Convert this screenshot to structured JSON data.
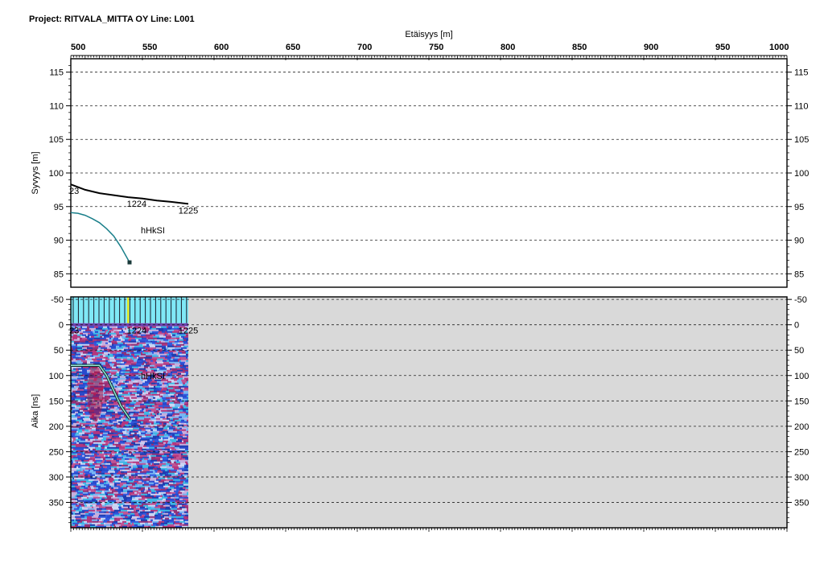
{
  "header": {
    "title": "Project: RITVALA_MITTA OY  Line: L001"
  },
  "chart_data": [
    {
      "type": "line",
      "title": "",
      "xlabel": "Etäisyys [m]",
      "ylabel": "Syvyys [m]",
      "xlim": [
        500,
        1000
      ],
      "ylim": [
        83,
        117
      ],
      "x_ticks": [
        "500",
        "550",
        "600",
        "650",
        "700",
        "750",
        "800",
        "850",
        "900",
        "950",
        "1000"
      ],
      "y_ticks": [
        "85",
        "90",
        "95",
        "100",
        "105",
        "110",
        "115"
      ],
      "grid": true,
      "series": [
        {
          "name": "",
          "color": "#000000",
          "x": [
            500,
            510,
            520,
            530,
            540,
            550,
            560,
            570,
            582
          ],
          "y": [
            98.3,
            97.5,
            97.0,
            96.7,
            96.4,
            96.2,
            95.9,
            95.7,
            95.4
          ]
        },
        {
          "name": "",
          "color": "#1a7f8a",
          "x": [
            500,
            505,
            510,
            515,
            520,
            525,
            530,
            535,
            541
          ],
          "y": [
            94.1,
            94.0,
            93.7,
            93.2,
            92.6,
            91.7,
            90.6,
            89.0,
            86.7
          ]
        }
      ],
      "point_labels": [
        {
          "text": "23",
          "x": 500,
          "y": 98.3
        },
        {
          "text": "1224",
          "x": 538,
          "y": 96.4
        },
        {
          "text": "1225",
          "x": 574,
          "y": 95.4
        }
      ],
      "annotations": [
        {
          "text": "hHkSI",
          "x": 550,
          "y": 91.5
        }
      ]
    },
    {
      "type": "heatmap",
      "title": "",
      "xlabel": "",
      "ylabel": "Aika [ns]",
      "xlim": [
        500,
        1000
      ],
      "ylim": [
        -55,
        400
      ],
      "data_x_range": [
        500,
        582
      ],
      "y_ticks": [
        "-50",
        "0",
        "50",
        "100",
        "150",
        "200",
        "250",
        "300",
        "350"
      ],
      "grid": true,
      "surface_marker_x": 540,
      "colors": {
        "background": "#d9d9d9",
        "header": "#7fe8f6",
        "signal_low": "#1e3cc8",
        "signal_high": "#e0205a",
        "interface": "#8fe0d0"
      },
      "interface_line": {
        "x": [
          500,
          520,
          525,
          530,
          535,
          541
        ],
        "y": [
          80,
          80,
          100,
          130,
          160,
          185
        ]
      },
      "point_labels": [
        {
          "text": "23",
          "x": 500,
          "y": 12
        },
        {
          "text": "1224",
          "x": 538,
          "y": 12
        },
        {
          "text": "1225",
          "x": 574,
          "y": 12
        }
      ],
      "annotations": [
        {
          "text": "hHkSI",
          "x": 550,
          "y": 100
        }
      ]
    }
  ]
}
